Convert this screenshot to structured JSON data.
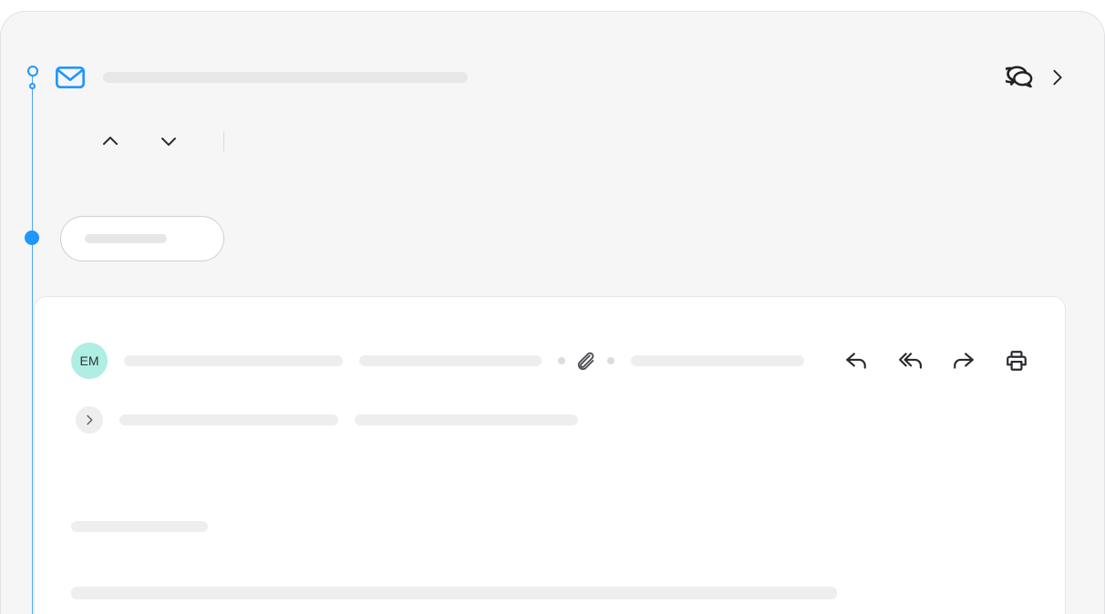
{
  "avatar": {
    "initials": "EM"
  },
  "icons": {
    "mail": "mail-icon",
    "chat": "chat-icon",
    "next": "chevron-right-icon",
    "up": "chevron-up-icon",
    "down": "chevron-down-icon",
    "reply": "reply-icon",
    "reply_all": "reply-all-icon",
    "forward": "forward-icon",
    "print": "print-icon",
    "paperclip": "attachment-icon",
    "expand": "chevron-right-icon"
  }
}
